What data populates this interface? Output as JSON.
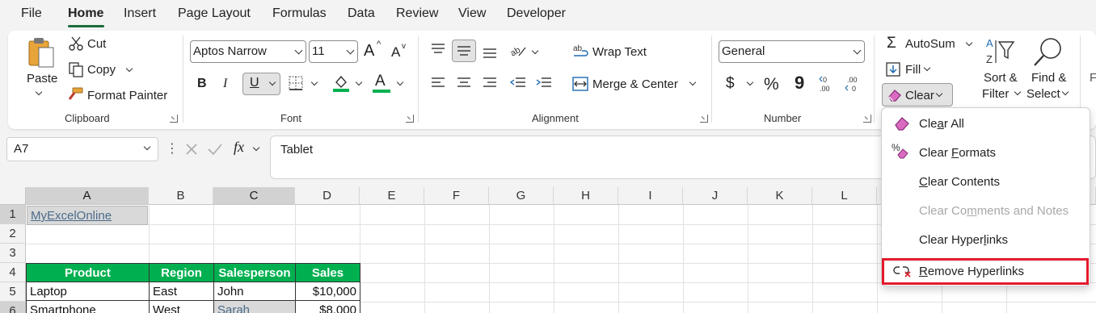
{
  "menu": {
    "tabs": [
      "File",
      "Home",
      "Insert",
      "Page Layout",
      "Formulas",
      "Data",
      "Review",
      "View",
      "Developer"
    ],
    "active": "Home"
  },
  "clipboard": {
    "paste": "Paste",
    "cut": "Cut",
    "copy": "Copy",
    "format_painter": "Format Painter",
    "group_label": "Clipboard"
  },
  "font": {
    "name": "Aptos Narrow",
    "size": "11",
    "group_label": "Font",
    "bold": "B",
    "italic": "I",
    "underline": "U",
    "grow": "A",
    "shrink": "A",
    "font_color": "A",
    "font_color_hex": "#e21b2c",
    "fill_color_hex": "#00b050"
  },
  "alignment": {
    "wrap_text": "Wrap Text",
    "merge_center": "Merge & Center",
    "group_label": "Alignment"
  },
  "number": {
    "format": "General",
    "currency": "$",
    "percent": "%",
    "comma": "9",
    "group_label": "Number"
  },
  "editing": {
    "autosum": "AutoSum",
    "fill": "Fill",
    "clear": "Clear",
    "sort_filter_1": "Sort &",
    "sort_filter_2": "Filter",
    "find_select_1": "Find &",
    "find_select_2": "Select"
  },
  "formula_bar": {
    "name_box": "A7",
    "fx": "fx",
    "content": "Tablet"
  },
  "grid": {
    "columns": [
      "A",
      "B",
      "C",
      "D",
      "E",
      "F",
      "G",
      "H",
      "I",
      "J",
      "K",
      "L"
    ],
    "rows": [
      "1",
      "2",
      "3",
      "4",
      "5",
      "6"
    ],
    "a1": "MyExcelOnline",
    "headers": [
      "Product",
      "Region",
      "Salesperson",
      "Sales"
    ],
    "row5": [
      "Laptop",
      "East",
      "John",
      "$10,000"
    ],
    "row6": [
      "Smartphone",
      "West",
      "Sarah",
      "$8,000"
    ]
  },
  "clear_menu": {
    "items": [
      {
        "pre": "Cle",
        "u": "a",
        "post": "r All",
        "enabled": true
      },
      {
        "pre": "Clear ",
        "u": "F",
        "post": "ormats",
        "enabled": true
      },
      {
        "pre": "",
        "u": "C",
        "post": "lear Contents",
        "enabled": true
      },
      {
        "pre": "Clear Co",
        "u": "m",
        "post": "ments and Notes",
        "enabled": false
      },
      {
        "pre": "Clear Hyper",
        "u": "l",
        "post": "inks",
        "enabled": true
      },
      {
        "pre": "",
        "u": "R",
        "post": "emove Hyperlinks",
        "enabled": true
      }
    ],
    "highlight_color": "#e21b2c"
  }
}
